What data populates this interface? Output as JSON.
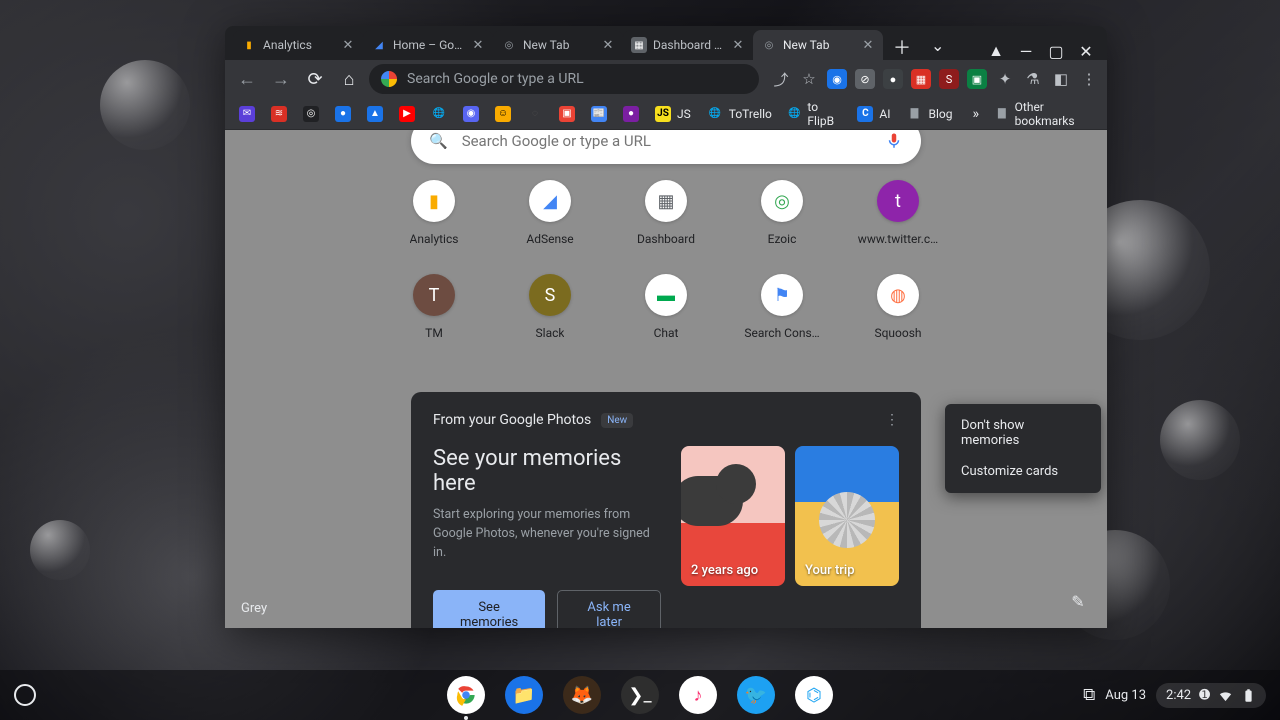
{
  "tabs": [
    {
      "title": "Analytics",
      "fav_bg": "#202124",
      "fav_fg": "#f9ab00",
      "fav_char": "▮"
    },
    {
      "title": "Home – Googl",
      "fav_bg": "#202124",
      "fav_fg": "#4285f4",
      "fav_char": "◢"
    },
    {
      "title": "New Tab",
      "fav_bg": "#202124",
      "fav_fg": "#9aa0a6",
      "fav_char": "◎"
    },
    {
      "title": "Dashboard ‹ Al",
      "fav_bg": "#5f6368",
      "fav_fg": "#fff",
      "fav_char": "▦"
    },
    {
      "title": "New Tab",
      "fav_bg": "#202124",
      "fav_fg": "#9aa0a6",
      "fav_char": "◎"
    }
  ],
  "active_tab_index": 4,
  "omnibox": {
    "placeholder": "Search Google or type a URL"
  },
  "bookmarks": [
    {
      "label": "",
      "bg": "#5b3fd9",
      "char": "✉"
    },
    {
      "label": "",
      "bg": "#d93025",
      "char": "≋"
    },
    {
      "label": "",
      "bg": "#202124",
      "char": "◎"
    },
    {
      "label": "",
      "bg": "#1a73e8",
      "char": "●"
    },
    {
      "label": "",
      "bg": "#1a73e8",
      "char": "▲"
    },
    {
      "label": "",
      "bg": "#ff0000",
      "char": "▶"
    },
    {
      "label": "",
      "bg": "#5f6368",
      "char": "🌐"
    },
    {
      "label": "",
      "bg": "#5865f2",
      "char": "◉"
    },
    {
      "label": "",
      "bg": "#f9ab00",
      "char": "☺"
    },
    {
      "label": "",
      "bg": "#333333",
      "char": "◌"
    },
    {
      "label": "",
      "bg": "#ea4335",
      "char": "▣"
    },
    {
      "label": "",
      "bg": "#4285f4",
      "char": "📰"
    },
    {
      "label": "",
      "bg": "#7b1fa2",
      "char": "●"
    },
    {
      "label": "JS",
      "bg": "#f7df1e",
      "char": "JS",
      "text": "JS"
    },
    {
      "label": "",
      "bg": "#5f6368",
      "char": "🌐",
      "text": "ToTrello"
    },
    {
      "label": "",
      "bg": "#5f6368",
      "char": "🌐",
      "text": "to FlipB"
    },
    {
      "label": "",
      "bg": "#1a73e8",
      "char": "C",
      "text": "AI"
    },
    {
      "label": "",
      "bg": "#5f6368",
      "char": "▇",
      "text": "Blog"
    }
  ],
  "other_bookmarks_label": "Other bookmarks",
  "search_pill": {
    "placeholder": "Search Google or type a URL"
  },
  "shortcuts": [
    {
      "label": "Analytics",
      "bg": "#ffffff",
      "fg": "#f9ab00",
      "char": "▮"
    },
    {
      "label": "AdSense",
      "bg": "#ffffff",
      "fg": "#4285f4",
      "char": "◢"
    },
    {
      "label": "Dashboard",
      "bg": "#ffffff",
      "fg": "#5f6368",
      "char": "▦"
    },
    {
      "label": "Ezoic",
      "bg": "#ffffff",
      "fg": "#34a853",
      "char": "◎"
    },
    {
      "label": "www.twitter.c…",
      "bg": "#8e24aa",
      "fg": "#ffffff",
      "char": "t"
    },
    {
      "label": "TM",
      "bg": "#6d4c41",
      "fg": "#ffffff",
      "char": "T"
    },
    {
      "label": "Slack",
      "bg": "#7b6b1f",
      "fg": "#ffffff",
      "char": "S"
    },
    {
      "label": "Chat",
      "bg": "#ffffff",
      "fg": "#00a94f",
      "char": "▬"
    },
    {
      "label": "Search Cons…",
      "bg": "#ffffff",
      "fg": "#4285f4",
      "char": "⚑"
    },
    {
      "label": "Squoosh",
      "bg": "#ffffff",
      "fg": "#ff7043",
      "char": "◍"
    }
  ],
  "photos_card": {
    "heading": "From your Google Photos",
    "badge": "New",
    "title": "See your memories here",
    "subtitle": "Start exploring your memories from Google Photos, whenever you're signed in.",
    "primary_btn": "See memories",
    "secondary_btn": "Ask me later",
    "mem1_caption": "2 years ago",
    "mem2_caption": "Your trip"
  },
  "context_menu": {
    "item1": "Don't show memories",
    "item2": "Customize cards"
  },
  "theme_label": "Grey",
  "shelf": {
    "date": "Aug 13",
    "time": "2:42"
  }
}
